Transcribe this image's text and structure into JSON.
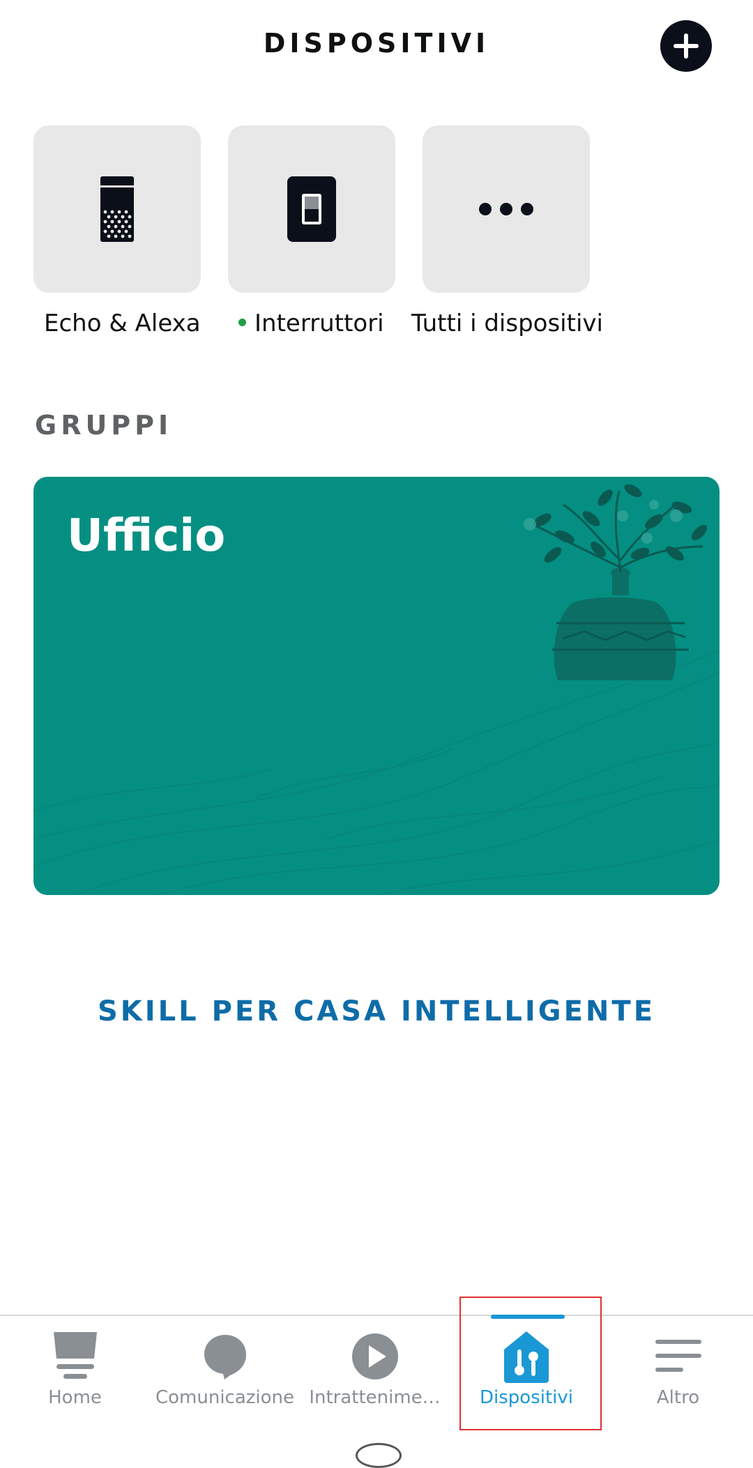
{
  "header": {
    "title": "DISPOSITIVI",
    "add_icon": "plus-icon"
  },
  "categories": [
    {
      "label": "Echo & Alexa",
      "icon": "echo-speaker-icon"
    },
    {
      "label": "Interruttori",
      "icon": "switch-icon",
      "status_color": "#1f9e48"
    },
    {
      "label": "Tutti i dispositivi",
      "icon": "more-dots-icon"
    }
  ],
  "groups_section": {
    "title": "GRUPPI",
    "groups": [
      {
        "name": "Ufficio",
        "color": "#048f82"
      }
    ]
  },
  "skills_link": "SKILL PER CASA INTELLIGENTE",
  "bottom_nav": {
    "items": [
      {
        "label": "Home",
        "icon": "home-icon"
      },
      {
        "label": "Comunicazione",
        "icon": "speech-bubble-icon"
      },
      {
        "label": "Intrattenime…",
        "icon": "play-icon"
      },
      {
        "label": "Dispositivi",
        "icon": "devices-house-icon",
        "active": true
      },
      {
        "label": "Altro",
        "icon": "menu-lines-icon"
      }
    ]
  },
  "colors": {
    "accent": "#1a98d5",
    "link": "#0e6ca8",
    "group_card": "#048f82",
    "highlight": "#e03131"
  }
}
